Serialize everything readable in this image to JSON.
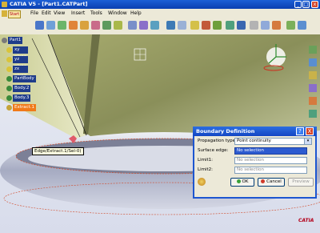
{
  "window": {
    "title": "CATIA V5 - [Part1.CATPart]",
    "minimize": "_",
    "maximize": "□",
    "close": "x"
  },
  "menu": {
    "start": "Start",
    "items": [
      "File",
      "Edit",
      "View",
      "Insert",
      "Tools",
      "Window",
      "Help"
    ]
  },
  "tree": {
    "items": [
      "Part1",
      "xy plane",
      "yz plane",
      "zx plane",
      "PartBody",
      "Body.2",
      "Body.3",
      "Extract.1"
    ]
  },
  "viewport": {
    "tooltip": "Edge/Extract.1/Sel-0)"
  },
  "dialog": {
    "title": "Boundary Definition",
    "help": "?",
    "close": "X",
    "propagation_label": "Propagation type:",
    "propagation_value": "Point continuity",
    "surface_edge_label": "Surface edge:",
    "surface_edge_value": "No selection",
    "limit1_label": "Limit1:",
    "limit1_value": "No selection",
    "limit2_label": "Limit2:",
    "limit2_value": "No selection",
    "ok_label": "OK",
    "cancel_label": "Cancel",
    "preview_label": "Preview"
  },
  "logo": "CATIA",
  "colors": {
    "title_blue": "#0a3fb0",
    "tree_node": "#1f3c8a",
    "tree_highlight": "#f07a1a",
    "surface": "#8a8f5a",
    "dialog_border": "#1d56d0"
  },
  "icons": [
    "catia-app-icon",
    "part-icon",
    "plane-icon",
    "body-icon",
    "compass-icon",
    "ok-icon",
    "cancel-icon"
  ]
}
